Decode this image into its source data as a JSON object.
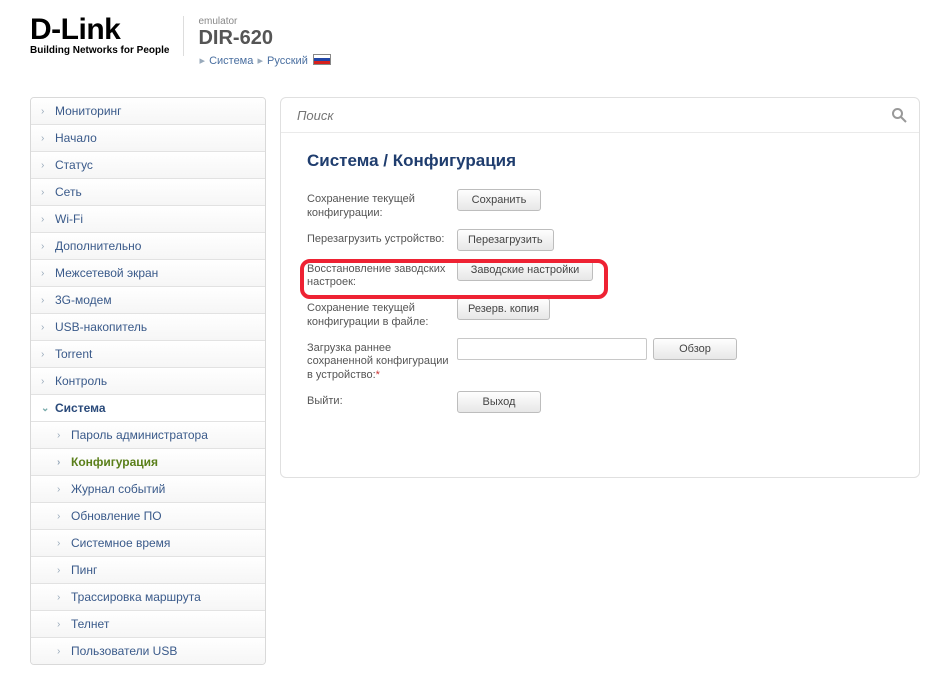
{
  "header": {
    "logo_word": "D-Link",
    "logo_tag": "Building Networks for People",
    "emulator": "emulator",
    "model": "DIR-620",
    "crumb1": "Система",
    "crumb2": "Русский"
  },
  "sidebar": {
    "items": [
      {
        "label": "Мониторинг"
      },
      {
        "label": "Начало"
      },
      {
        "label": "Статус"
      },
      {
        "label": "Сеть"
      },
      {
        "label": "Wi-Fi"
      },
      {
        "label": "Дополнительно"
      },
      {
        "label": "Межсетевой экран"
      },
      {
        "label": "3G-модем"
      },
      {
        "label": "USB-накопитель"
      },
      {
        "label": "Torrent"
      },
      {
        "label": "Контроль"
      },
      {
        "label": "Система",
        "open": true
      }
    ],
    "sub": [
      {
        "label": "Пароль администратора"
      },
      {
        "label": "Конфигурация",
        "active": true
      },
      {
        "label": "Журнал событий"
      },
      {
        "label": "Обновление ПО"
      },
      {
        "label": "Системное время"
      },
      {
        "label": "Пинг"
      },
      {
        "label": "Трассировка маршрута"
      },
      {
        "label": "Телнет"
      },
      {
        "label": "Пользователи USB"
      }
    ]
  },
  "content": {
    "search_placeholder": "Поиск",
    "title": "Система /  Конфигурация",
    "rows": {
      "save": {
        "label": "Сохранение текущей конфигурации:",
        "button": "Сохранить"
      },
      "reboot": {
        "label": "Перезагрузить устройство:",
        "button": "Перезагрузить"
      },
      "factory": {
        "label": "Восстановление заводских настроек:",
        "button": "Заводские настройки"
      },
      "backup": {
        "label": "Сохранение текущей конфигурации в файле:",
        "button": "Резерв. копия"
      },
      "restore": {
        "label": "Загрузка раннее сохраненной конфигурации в устройство:",
        "button": "Обзор"
      },
      "logout": {
        "label": "Выйти:",
        "button": "Выход"
      }
    }
  }
}
